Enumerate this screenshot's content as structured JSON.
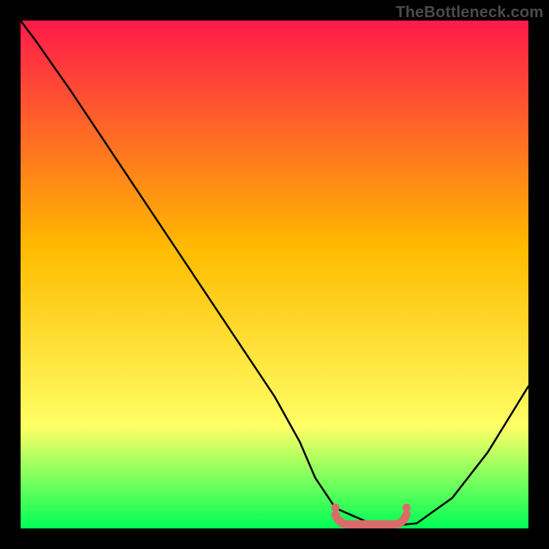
{
  "watermark": "TheBottleneck.com",
  "colors": {
    "frame": "#000000",
    "gradient_top": "#ff1a4b",
    "gradient_mid": "#ffbb00",
    "gradient_low": "#ffff66",
    "gradient_bottom": "#00ff55",
    "curve": "#000000",
    "marker": "#d96b6b"
  },
  "chart_data": {
    "type": "line",
    "title": "",
    "xlabel": "",
    "ylabel": "",
    "xlim": [
      0,
      100
    ],
    "ylim": [
      0,
      100
    ],
    "grid": false,
    "series": [
      {
        "name": "bottleneck-curve",
        "x": [
          0,
          3,
          10,
          20,
          30,
          40,
          50,
          55,
          58,
          62,
          70,
          73,
          78,
          85,
          92,
          100
        ],
        "y": [
          100,
          96,
          86,
          71,
          56,
          41,
          26,
          17,
          10,
          4,
          0.5,
          0.5,
          1,
          6,
          15,
          28
        ]
      }
    ],
    "markers": [
      {
        "name": "optimal-range-left-cap",
        "x": 62,
        "y": 3
      },
      {
        "name": "optimal-range-right-cap",
        "x": 76,
        "y": 3
      }
    ],
    "marker_segment": {
      "x_start": 62,
      "x_end": 76,
      "y": 0.8
    }
  }
}
